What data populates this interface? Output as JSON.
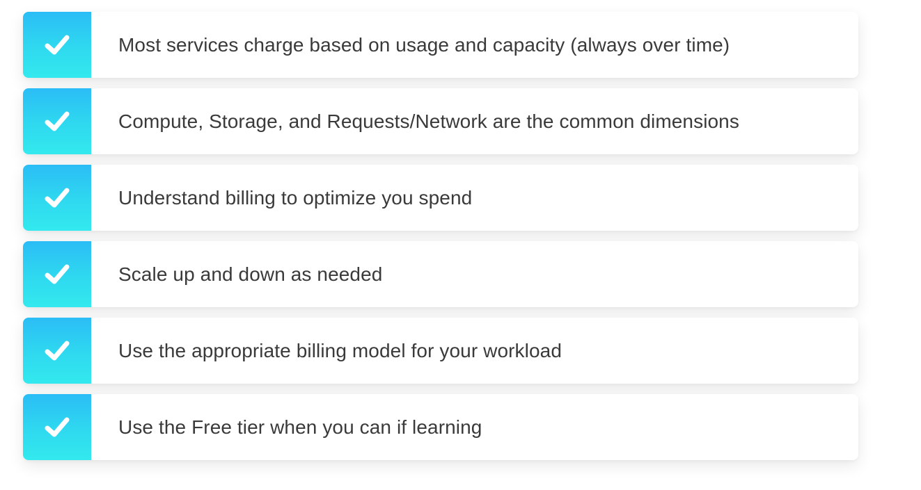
{
  "checklist": {
    "icon": "checkmark-icon",
    "accent_color": "#2fd9ef",
    "items": [
      {
        "label": "Most services charge based on usage and capacity (always over time)"
      },
      {
        "label": "Compute, Storage, and Requests/Network are the common dimensions"
      },
      {
        "label": "Understand billing to optimize you spend"
      },
      {
        "label": "Scale up and down as needed"
      },
      {
        "label": "Use the appropriate billing model for your workload"
      },
      {
        "label": "Use the Free tier when you can if learning"
      }
    ]
  }
}
